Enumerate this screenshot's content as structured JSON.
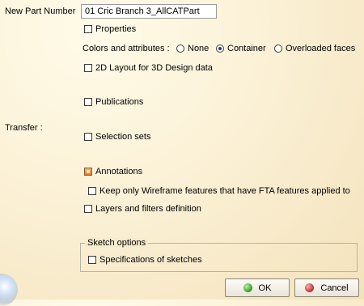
{
  "new_part_number": {
    "label": "New Part Number",
    "value": "01 Cric Branch 3_AllCATPart"
  },
  "properties": {
    "label": "Properties",
    "checked": false
  },
  "colors": {
    "label": "Colors and attributes :",
    "options": [
      {
        "label": "None",
        "selected": false
      },
      {
        "label": "Container",
        "selected": true
      },
      {
        "label": "Overloaded faces",
        "selected": false
      }
    ]
  },
  "layout_2d": {
    "label": "2D Layout for 3D Design data",
    "checked": false
  },
  "publications": {
    "label": "Publications",
    "checked": false
  },
  "transfer_label": "Transfer :",
  "selection_sets": {
    "label": "Selection sets",
    "checked": false
  },
  "annotations": {
    "label": "Annotations",
    "checked": true
  },
  "keep_wireframe": {
    "label": "Keep only Wireframe features that have FTA features applied to",
    "checked": false
  },
  "layers_filters": {
    "label": "Layers and filters definition",
    "checked": false
  },
  "sketch_options": {
    "title": "Sketch options",
    "specifications": {
      "label": "Specifications of sketches",
      "checked": false
    }
  },
  "buttons": {
    "ok": "OK",
    "cancel": "Cancel"
  },
  "colors_palette": {
    "accent_ok": "#2e9a1e",
    "accent_cancel": "#c42a2a",
    "checked_box": "#e27a25"
  }
}
